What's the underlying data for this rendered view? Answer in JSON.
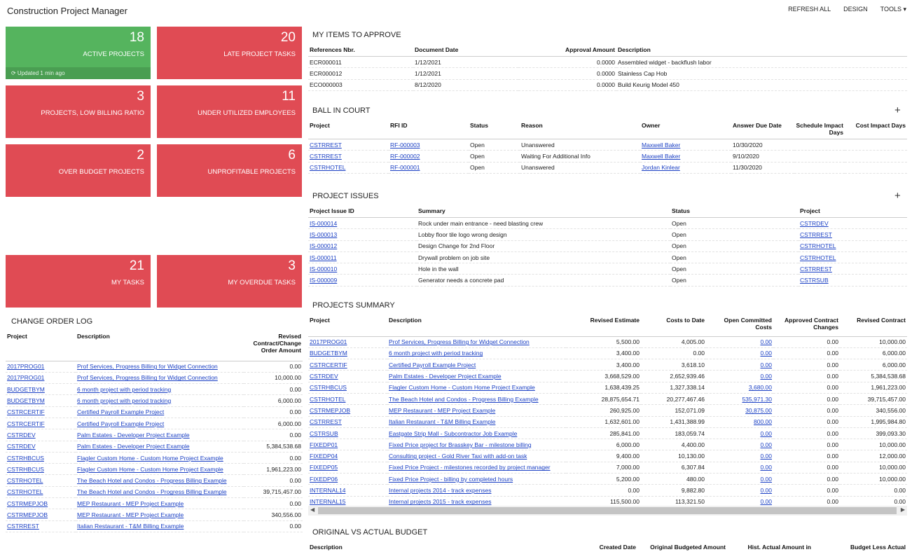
{
  "app_title": "Construction Project Manager",
  "top_menu": {
    "refresh": "REFRESH ALL",
    "design": "DESIGN",
    "tools": "TOOLS ▾"
  },
  "tiles": {
    "active_projects": {
      "num": "18",
      "label": "ACTIVE PROJECTS",
      "updated": "⟳ Updated 1 min ago"
    },
    "late_tasks": {
      "num": "20",
      "label": "LATE PROJECT TASKS"
    },
    "low_billing": {
      "num": "3",
      "label": "PROJECTS, LOW BILLING RATIO"
    },
    "under_utilized": {
      "num": "11",
      "label": "UNDER UTILIZED EMPLOYEES"
    },
    "over_budget": {
      "num": "2",
      "label": "OVER BUDGET PROJECTS"
    },
    "unprofitable": {
      "num": "6",
      "label": "UNPROFITABLE PROJECTS"
    },
    "my_tasks": {
      "num": "21",
      "label": "MY TASKS"
    },
    "overdue": {
      "num": "3",
      "label": "MY OVERDUE TASKS"
    }
  },
  "approve": {
    "title": "MY ITEMS TO APPROVE",
    "headers": [
      "References Nbr.",
      "Document Date",
      "Approval Amount",
      "Description"
    ],
    "rows": [
      [
        "ECR000011",
        "1/12/2021",
        "0.0000",
        "Assembled widget - backflush labor"
      ],
      [
        "ECR000012",
        "1/12/2021",
        "0.0000",
        "Stainless Cap Hob"
      ],
      [
        "ECO000003",
        "8/12/2020",
        "0.0000",
        "Build Keurig Model 450"
      ]
    ]
  },
  "ball": {
    "title": "BALL IN COURT",
    "plus": "+",
    "headers": [
      "Project",
      "RFI ID",
      "Status",
      "Reason",
      "Owner",
      "Answer Due Date",
      "Schedule Impact Days",
      "Cost Impact Days"
    ],
    "rows": [
      [
        "CSTRREST",
        "RF-000003",
        "Open",
        "Unanswered",
        "Maxwell Baker",
        "10/30/2020"
      ],
      [
        "CSTRREST",
        "RF-000002",
        "Open",
        "Waiting For Additional Info",
        "Maxwell Baker",
        "9/10/2020"
      ],
      [
        "CSTRHOTEL",
        "RF-000001",
        "Open",
        "Unanswered",
        "Jordan Kinlear",
        "11/30/2020"
      ]
    ]
  },
  "issues": {
    "title": "PROJECT ISSUES",
    "plus": "+",
    "headers": [
      "Project Issue ID",
      "Summary",
      "Status",
      "Project"
    ],
    "rows": [
      [
        "IS-000014",
        "Rock under main entrance - need blasting crew",
        "Open",
        "CSTRDEV"
      ],
      [
        "IS-000013",
        "Lobby floor tile logo wrong design",
        "Open",
        "CSTRREST"
      ],
      [
        "IS-000012",
        "Design Change for 2nd Floor",
        "Open",
        "CSTRHOTEL"
      ],
      [
        "IS-000011",
        "Drywall problem on job site",
        "Open",
        "CSTRHOTEL"
      ],
      [
        "IS-000010",
        "Hole in the wall",
        "Open",
        "CSTRREST"
      ],
      [
        "IS-000009",
        "Generator needs a concrete pad",
        "Open",
        "CSTRSUB"
      ]
    ]
  },
  "change_log": {
    "title": "CHANGE ORDER LOG",
    "headers": [
      "Project",
      "Description",
      "Revised Contract/Change Order Amount"
    ],
    "rows": [
      [
        "2017PROG01",
        "Prof Services, Progress Billing for Widget Connection",
        "0.00"
      ],
      [
        "2017PROG01",
        "Prof Services, Progress Billing for Widget Connection",
        "10,000.00"
      ],
      [
        "BUDGETBYM",
        "6 month project with period tracking",
        "0.00"
      ],
      [
        "BUDGETBYM",
        "6 month project with period tracking",
        "6,000.00"
      ],
      [
        "CSTRCERTIF",
        "Certified Payroll Example Project",
        "0.00"
      ],
      [
        "CSTRCERTIF",
        "Certified Payroll Example Project",
        "6,000.00"
      ],
      [
        "CSTRDEV",
        "Palm Estates - Developer Project Example",
        "0.00"
      ],
      [
        "CSTRDEV",
        "Palm Estates - Developer Project Example",
        "5,384,538.68"
      ],
      [
        "CSTRHBCUS",
        "Flagler Custom Home - Custom Home Project Example",
        "0.00"
      ],
      [
        "CSTRHBCUS",
        "Flagler Custom Home - Custom Home Project Example",
        "1,961,223.00"
      ],
      [
        "CSTRHOTEL",
        "The Beach Hotel and Condos - Progress Billing Example",
        "0.00"
      ],
      [
        "CSTRHOTEL",
        "The Beach Hotel and Condos - Progress Billing Example",
        "39,715,457.00"
      ],
      [
        "CSTRMEPJOB",
        "MEP Restaurant - MEP Project Example",
        "0.00"
      ],
      [
        "CSTRMEPJOB",
        "MEP Restaurant - MEP Project Example",
        "340,556.00"
      ],
      [
        "CSTRREST",
        "Italian Restaurant - T&M Billing Example",
        "0.00"
      ]
    ]
  },
  "summary": {
    "title": "PROJECTS SUMMARY",
    "headers": [
      "Project",
      "Description",
      "Revised Estimate",
      "Costs to Date",
      "Open Committed Costs",
      "Approved Contract Changes",
      "Revised Contract"
    ],
    "rows": [
      [
        "2017PROG01",
        "Prof Services, Progress Billing for Widget Connection",
        "5,500.00",
        "4,005.00",
        "0.00",
        "0.00",
        "10,000.00"
      ],
      [
        "BUDGETBYM",
        "6 month project with period tracking",
        "3,400.00",
        "0.00",
        "0.00",
        "0.00",
        "6,000.00"
      ],
      [
        "CSTRCERTIF",
        "Certified Payroll Example Project",
        "3,400.00",
        "3,618.10",
        "0.00",
        "0.00",
        "6,000.00"
      ],
      [
        "CSTRDEV",
        "Palm Estates - Developer Project Example",
        "3,668,529.00",
        "2,652,939.46",
        "0.00",
        "0.00",
        "5,384,538.68"
      ],
      [
        "CSTRHBCUS",
        "Flagler Custom Home - Custom Home Project Example",
        "1,638,439.25",
        "1,327,338.14",
        "3,680.00",
        "0.00",
        "1,961,223.00"
      ],
      [
        "CSTRHOTEL",
        "The Beach Hotel and Condos - Progress Billing Example",
        "28,875,654.71",
        "20,277,467.46",
        "535,971.30",
        "0.00",
        "39,715,457.00"
      ],
      [
        "CSTRMEPJOB",
        "MEP Restaurant - MEP Project Example",
        "260,925.00",
        "152,071.09",
        "30,875.00",
        "0.00",
        "340,556.00"
      ],
      [
        "CSTRREST",
        "Italian Restaurant - T&M Billing Example",
        "1,632,601.00",
        "1,431,388.99",
        "800.00",
        "0.00",
        "1,995,984.80"
      ],
      [
        "CSTRSUB",
        "Eastgate Strip Mall - Subcontractor Job Example",
        "285,841.00",
        "183,059.74",
        "0.00",
        "0.00",
        "399,093.30"
      ],
      [
        "FIXEDP01",
        "Fixed Price project for Brasskey Bar - milestone billing",
        "6,000.00",
        "4,400.00",
        "0.00",
        "0.00",
        "10,000.00"
      ],
      [
        "FIXEDP04",
        "Consulting project - Gold River Taxi with add-on task",
        "9,400.00",
        "10,130.00",
        "0.00",
        "0.00",
        "12,000.00"
      ],
      [
        "FIXEDP05",
        "Fixed Price Project - milestones recorded by project manager",
        "7,000.00",
        "6,307.84",
        "0.00",
        "0.00",
        "10,000.00"
      ],
      [
        "FIXEDP06",
        "Fixed Price Project - billing by completed hours",
        "5,200.00",
        "480.00",
        "0.00",
        "0.00",
        "10,000.00"
      ],
      [
        "INTERNAL14",
        "Internal projects 2014 - track expenses",
        "0.00",
        "9,882.80",
        "0.00",
        "0.00",
        "0.00"
      ],
      [
        "INTERNAL15",
        "Internal projects 2015 - track expenses",
        "115,500.00",
        "113,321.50",
        "0.00",
        "0.00",
        "0.00"
      ]
    ]
  },
  "budget": {
    "title": "ORIGINAL VS ACTUAL BUDGET",
    "headers": [
      "Description",
      "Created Date",
      "Original Budgeted Amount",
      "Hist. Actual Amount in",
      "Budget Less Actual"
    ]
  }
}
